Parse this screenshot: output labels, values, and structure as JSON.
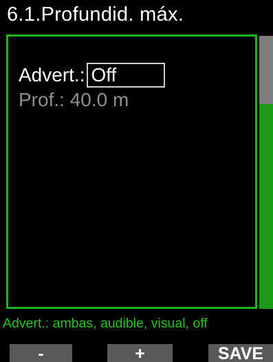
{
  "header": {
    "title": "6.1.Profundid. máx."
  },
  "settings": {
    "warning_label": "Advert.:",
    "warning_value": "Off",
    "depth_label": "Prof.:",
    "depth_value": "40.0 m"
  },
  "hint": {
    "text": "Advert.: ambas, audible, visual, off"
  },
  "softkeys": {
    "minus_label": "-",
    "plus_label": "+",
    "save_label": "SAVE"
  },
  "colors": {
    "accent": "#1fb51a",
    "hint_text": "#22c41c",
    "softkey_bg": "#595959",
    "dim_text": "#8f8f8f"
  },
  "scroll": {
    "position_fraction": 0.0,
    "visible_fraction": 0.25
  }
}
